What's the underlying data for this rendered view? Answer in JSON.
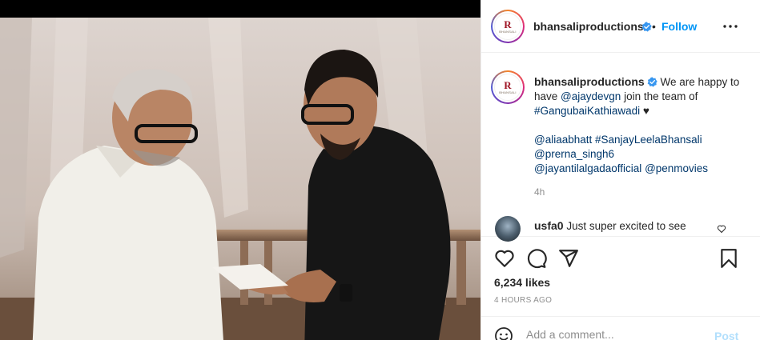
{
  "post": {
    "username": "bhansaliproductions",
    "follow_label": "Follow",
    "separator": "•",
    "caption": {
      "text_1": "We are happy to have",
      "mention_1": "@ajaydevgn",
      "text_2": "join the team of",
      "hashtag_1": "#GangubaiKathiawadi",
      "emoji": "♥",
      "mention_2": "@aliaabhatt",
      "hashtag_2": "#SanjayLeelaBhansali",
      "mention_3": "@prerna_singh6",
      "mention_4": "@jayantilalgadaofficial",
      "mention_5": "@penmovies"
    },
    "caption_time": "4h",
    "likes": "6,234 likes",
    "posted_ago": "4 HOURS AGO"
  },
  "comment": {
    "username": "usfa0",
    "text": "Just super excited to see"
  },
  "add_comment": {
    "placeholder": "Add a comment...",
    "post_label": "Post"
  },
  "colors": {
    "link": "#00376b",
    "follow": "#0095f6",
    "verified": "#3897f0",
    "post_disabled": "#b2dffc"
  },
  "icons": [
    "verified-badge-icon",
    "more-options-icon",
    "heart-icon",
    "comment-icon",
    "share-icon",
    "bookmark-icon",
    "emoji-icon",
    "comment-like-icon"
  ]
}
